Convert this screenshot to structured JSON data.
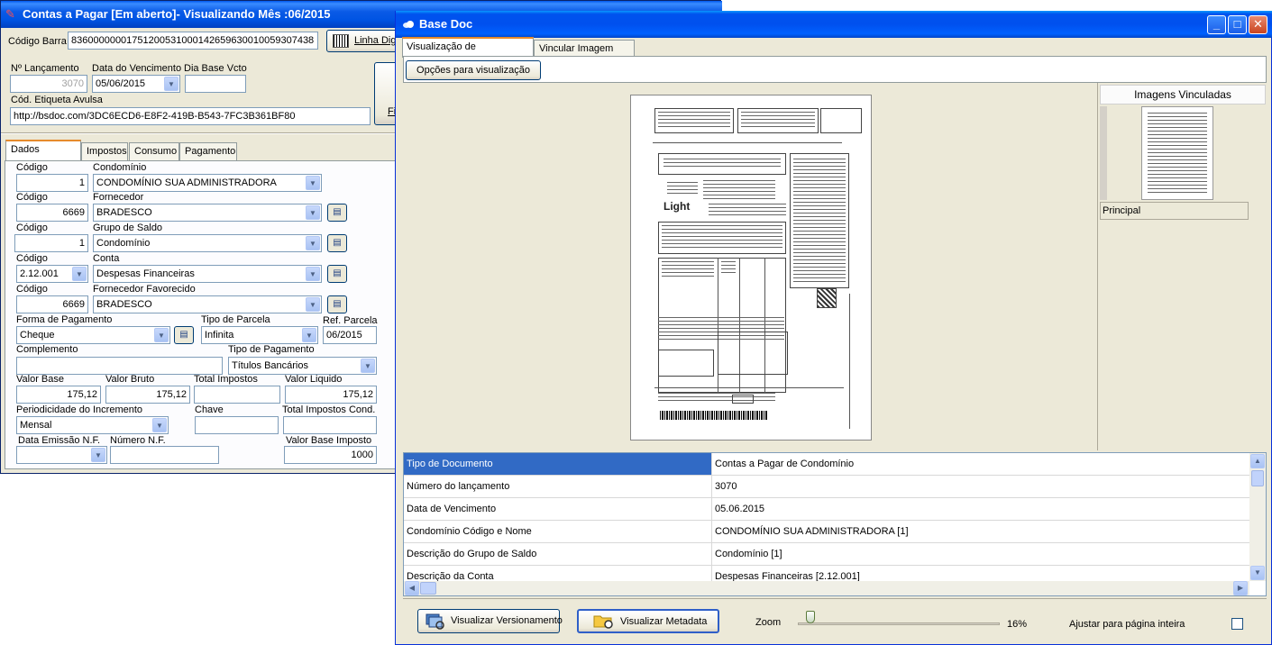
{
  "win1": {
    "title": "Contas a Pagar [Em aberto]- Visualizando Mês :06/2015",
    "codigo_barra_label": "Código Barra",
    "codigo_barra_value": "83600000001751200531000142659630010059307438",
    "linha_digitavel_label": "Linha Digi",
    "filter_btn_label": "Fi",
    "n_lancamento_label": "Nº Lançamento",
    "n_lancamento_value": "3070",
    "data_vencimento_label": "Data do Vencimento",
    "data_vencimento_value": "05/06/2015",
    "dia_base_label": "Dia Base Vcto",
    "dia_base_value": "",
    "etiqueta_label": "Cód. Etiqueta Avulsa",
    "etiqueta_value": "http://bsdoc.com/3DC6ECD6-E8F2-419B-B543-7FC3B361BF80",
    "tabs": [
      "Dados Básicos",
      "Impostos",
      "Consumo",
      "Pagamento"
    ],
    "codigo_label": "Código",
    "condominio_label": "Condomínio",
    "condominio_code": "1",
    "condominio_value": "CONDOMÍNIO SUA ADMINISTRADORA",
    "fornecedor_label": "Fornecedor",
    "fornecedor_code": "6669",
    "fornecedor_value": "BRADESCO",
    "grupo_saldo_label": "Grupo de Saldo",
    "grupo_saldo_code": "1",
    "grupo_saldo_value": "Condomínio",
    "conta_label": "Conta",
    "conta_code": "2.12.001",
    "conta_value": "Despesas Financeiras",
    "fornecedor_fav_label": "Fornecedor Favorecido",
    "fornecedor_fav_code": "6669",
    "fornecedor_fav_value": "BRADESCO",
    "forma_pagamento_label": "Forma de Pagamento",
    "forma_pagamento_value": "Cheque",
    "tipo_parcela_label": "Tipo de Parcela",
    "tipo_parcela_value": "Infinita",
    "ref_parcela_label": "Ref. Parcela",
    "ref_parcela_value": "06/2015",
    "complemento_label": "Complemento",
    "complemento_value": "",
    "tipo_pagamento_label": "Tipo de Pagamento",
    "tipo_pagamento_value": "Títulos Bancários",
    "valor_base_label": "Valor Base",
    "valor_base_value": "175,12",
    "valor_bruto_label": "Valor Bruto",
    "valor_bruto_value": "175,12",
    "total_impostos_label": "Total Impostos",
    "total_impostos_value": "",
    "valor_liquido_label": "Valor Liquido",
    "valor_liquido_value": "175,12",
    "periodicidade_label": "Periodicidade do Incremento",
    "periodicidade_value": "Mensal",
    "chave_label": "Chave",
    "chave_value": "",
    "total_impostos_cond_label": "Total Impostos Cond.",
    "total_impostos_cond_value": "",
    "data_emissao_label": "Data Emissão N.F.",
    "numero_nf_label": "Número N.F.",
    "numero_nf_value": "",
    "valor_base_imposto_label": "Valor Base Imposto",
    "valor_base_imposto_value": "1000"
  },
  "win2": {
    "title": "Base Doc",
    "tabs": [
      "Visualização de Documentos",
      "Vincular Imagem Órfã"
    ],
    "opcoes_btn": "Opções para visualização",
    "imagens_header": "Imagens Vinculadas",
    "thumb_caption": "Principal",
    "document_brand": "Light",
    "metadata": [
      {
        "key": "Tipo de Documento",
        "value": "Contas a Pagar de Condomínio"
      },
      {
        "key": "Número do lançamento",
        "value": "3070"
      },
      {
        "key": "Data de Vencimento",
        "value": "05.06.2015"
      },
      {
        "key": "Condomínio Código e Nome",
        "value": "CONDOMÍNIO SUA ADMINISTRADORA [1]"
      },
      {
        "key": "Descrição do Grupo de Saldo",
        "value": "Condomínio [1]"
      },
      {
        "key": "Descrição da Conta",
        "value": "Despesas Financeiras [2.12.001]"
      }
    ],
    "btn_versionamento": "Visualizar Versionamento",
    "btn_metadata": "Visualizar Metadata",
    "zoom_label": "Zoom",
    "zoom_value": "16%",
    "zoom_fraction": 0.04,
    "ajustar_label": "Ajustar para página inteira",
    "ajustar_checked": false
  }
}
